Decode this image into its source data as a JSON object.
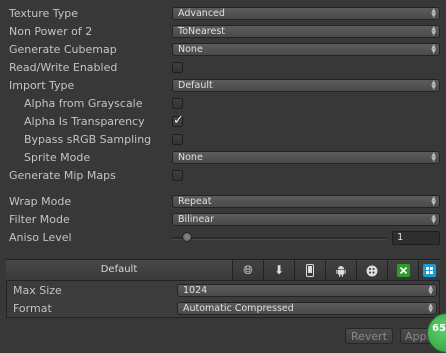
{
  "settings": {
    "texture_type": {
      "label": "Texture Type",
      "value": "Advanced"
    },
    "non_power_of_2": {
      "label": "Non Power of 2",
      "value": "ToNearest"
    },
    "generate_cubemap": {
      "label": "Generate Cubemap",
      "value": "None"
    },
    "read_write": {
      "label": "Read/Write Enabled",
      "checked": false
    },
    "import_type": {
      "label": "Import Type",
      "value": "Default"
    },
    "alpha_from_grayscale": {
      "label": "Alpha from Grayscale",
      "checked": false
    },
    "alpha_is_transparency": {
      "label": "Alpha Is Transparency",
      "checked": true
    },
    "bypass_srgb": {
      "label": "Bypass sRGB Sampling",
      "checked": false
    },
    "sprite_mode": {
      "label": "Sprite Mode",
      "value": "None"
    },
    "generate_mip_maps": {
      "label": "Generate Mip Maps",
      "checked": false
    },
    "wrap_mode": {
      "label": "Wrap Mode",
      "value": "Repeat"
    },
    "filter_mode": {
      "label": "Filter Mode",
      "value": "Bilinear"
    },
    "aniso_level": {
      "label": "Aniso Level",
      "value": "1"
    }
  },
  "platform": {
    "default_tab": "Default",
    "tabs": [
      "web-icon",
      "download-icon",
      "phone-icon",
      "android-icon",
      "blackberry-icon",
      "xbox-icon",
      "windows-store-icon"
    ],
    "tab_colors": {
      "xbox": "#2a9d2a",
      "windows": "#1e9ad6"
    }
  },
  "platform_settings": {
    "max_size": {
      "label": "Max Size",
      "value": "1024"
    },
    "format": {
      "label": "Format",
      "value": "Automatic Compressed"
    }
  },
  "buttons": {
    "revert": "Revert",
    "apply": "Appl"
  },
  "fps_badge": "65"
}
